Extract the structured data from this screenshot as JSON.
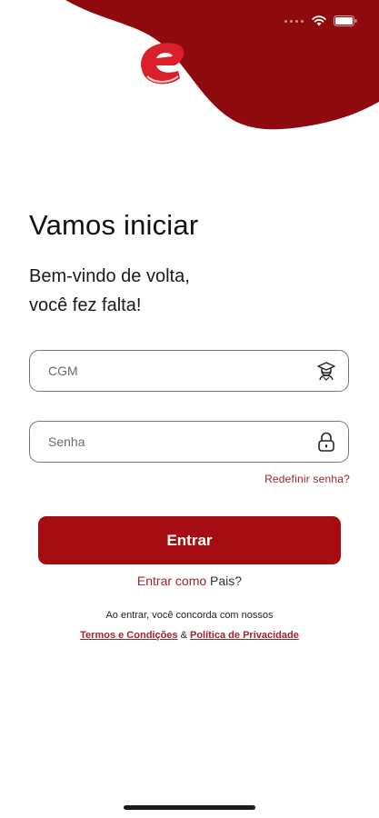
{
  "colors": {
    "brand": "#a50d12",
    "brand_dark": "#8f0a0f",
    "link": "#a0242b"
  },
  "status_bar": {
    "icons": [
      "wifi-icon",
      "battery-icon"
    ]
  },
  "header": {
    "logo": "e-logo"
  },
  "login": {
    "title": "Vamos iniciar",
    "subtitle_line1": "Bem-vindo de volta,",
    "subtitle_line2": "você fez falta!"
  },
  "form": {
    "cgm": {
      "placeholder": "CGM",
      "value": "",
      "icon": "student-icon"
    },
    "senha": {
      "placeholder": "Senha",
      "value": "",
      "icon": "lock-icon"
    },
    "forgot_label": "Redefinir senha?",
    "submit_label": "Entrar"
  },
  "parents": {
    "prefix": "Entrar como ",
    "suffix": "Pais?"
  },
  "terms": {
    "text": "Ao entrar, você concorda com nossos",
    "terms_link": "Termos e Condições",
    "separator": " & ",
    "privacy_link": "Política de Privacidade"
  }
}
